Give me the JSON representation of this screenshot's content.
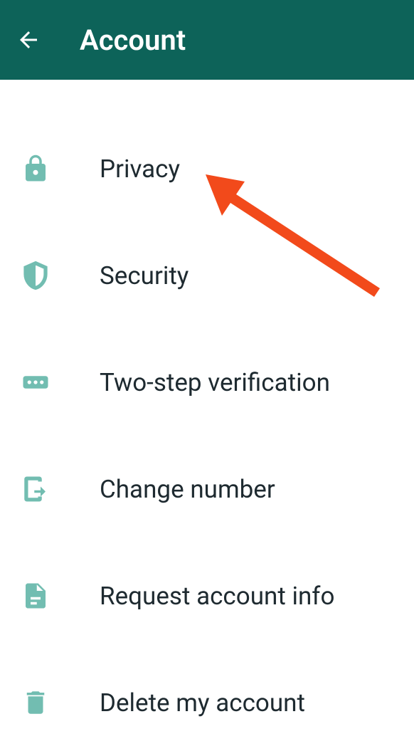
{
  "header": {
    "title": "Account"
  },
  "menu": {
    "items": [
      {
        "label": "Privacy",
        "icon": "lock-icon"
      },
      {
        "label": "Security",
        "icon": "shield-icon"
      },
      {
        "label": "Two-step verification",
        "icon": "dots-icon"
      },
      {
        "label": "Change number",
        "icon": "change-number-icon"
      },
      {
        "label": "Request account info",
        "icon": "document-icon"
      },
      {
        "label": "Delete my account",
        "icon": "trash-icon"
      }
    ]
  },
  "annotation": {
    "color": "#f24a1b"
  }
}
